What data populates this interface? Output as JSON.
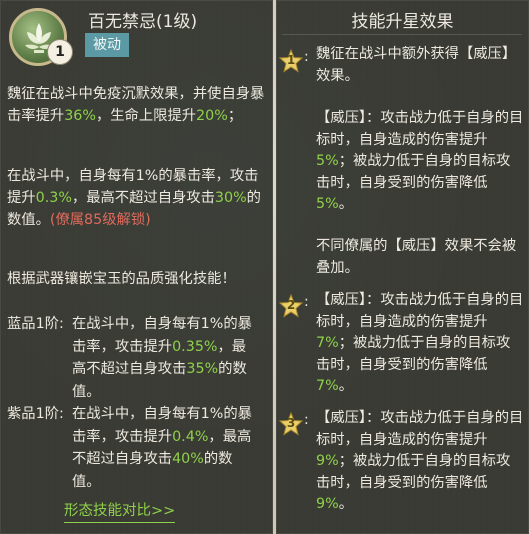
{
  "skill": {
    "name": "百无禁忌(1级)",
    "level_badge": "1",
    "type": "被动",
    "icon": "lotus-icon"
  },
  "description": {
    "p1": [
      "魏征在战斗中免疫沉默效果，并使自身暴击率提升",
      "36%",
      "，生命上限提升",
      "20%",
      "；"
    ],
    "p2": [
      "在战斗中，自身每有1%的暴击率，攻击提升",
      "0.3%",
      "，最高不超过自身攻击",
      "30%",
      "的数值。",
      "(僚属85级解锁)"
    ],
    "p3": "根据武器镶嵌宝玉的品质强化技能！",
    "tiers": [
      {
        "label": "蓝品1阶:",
        "parts": [
          "在战斗中，自身每有1%的暴击率，攻击提升",
          "0.35%",
          "，最高不超过自身攻击",
          "35%",
          "的数值。"
        ]
      },
      {
        "label": "紫品1阶:",
        "parts": [
          "在战斗中，自身每有1%的暴击率，攻击提升",
          "0.4%",
          "，最高不超过自身攻击",
          "40%",
          "的数值。"
        ]
      }
    ],
    "compare_link": "形态技能对比>>"
  },
  "star_panel": {
    "title": "技能升星效果",
    "stars": [
      {
        "num": "1",
        "lines": [
          "魏征在战斗中额外获得【威压】效果。"
        ],
        "detail": [
          "【威压】：攻击战力低于自身的目标时，自身造成的伤害提升",
          "5%",
          "；被战力低于自身的目标攻击时，自身受到的伤害降低",
          "5%",
          "。"
        ],
        "note": "不同僚属的【威压】效果不会被叠加。"
      },
      {
        "num": "2",
        "detail": [
          "【威压】：攻击战力低于自身的目标时，自身造成的伤害提升",
          "7%",
          "；被战力低于自身的目标攻击时，自身受到的伤害降低",
          "7%",
          "。"
        ]
      },
      {
        "num": "3",
        "detail": [
          "【威压】：攻击战力低于自身的目标时，自身造成的伤害提升",
          "9%",
          "；被战力低于自身的目标攻击时，自身受到的伤害降低",
          "9%",
          "。"
        ]
      }
    ]
  },
  "colors": {
    "highlight_green": "#8fd14a",
    "unlock_red": "#e06a5c",
    "tag_blue": "#5b9aa5",
    "panel_bg": "#141814"
  }
}
